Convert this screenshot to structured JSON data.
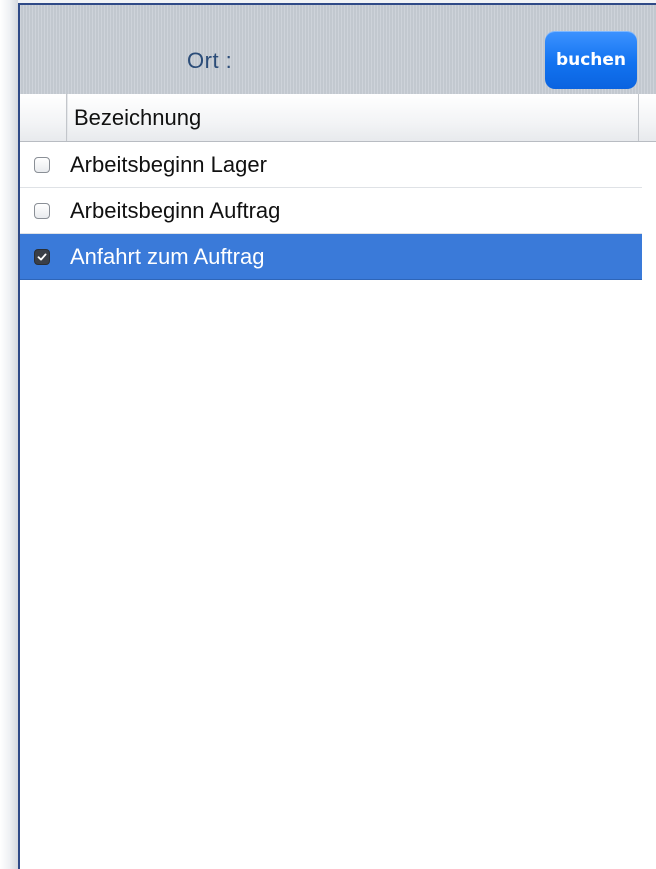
{
  "header": {
    "ort_label": "Ort :",
    "buchen_label": "buchen"
  },
  "table": {
    "column_header": "Bezeichnung",
    "rows": [
      {
        "label": "Arbeitsbeginn Lager",
        "checked": false
      },
      {
        "label": "Arbeitsbeginn Auftrag",
        "checked": false
      },
      {
        "label": "Anfahrt zum Auftrag",
        "checked": true
      }
    ]
  },
  "colors": {
    "accent_button": "#1273f0",
    "selected_row": "#3a7ad9",
    "frame_border": "#2f4a87",
    "label_text": "#2b4c78"
  }
}
